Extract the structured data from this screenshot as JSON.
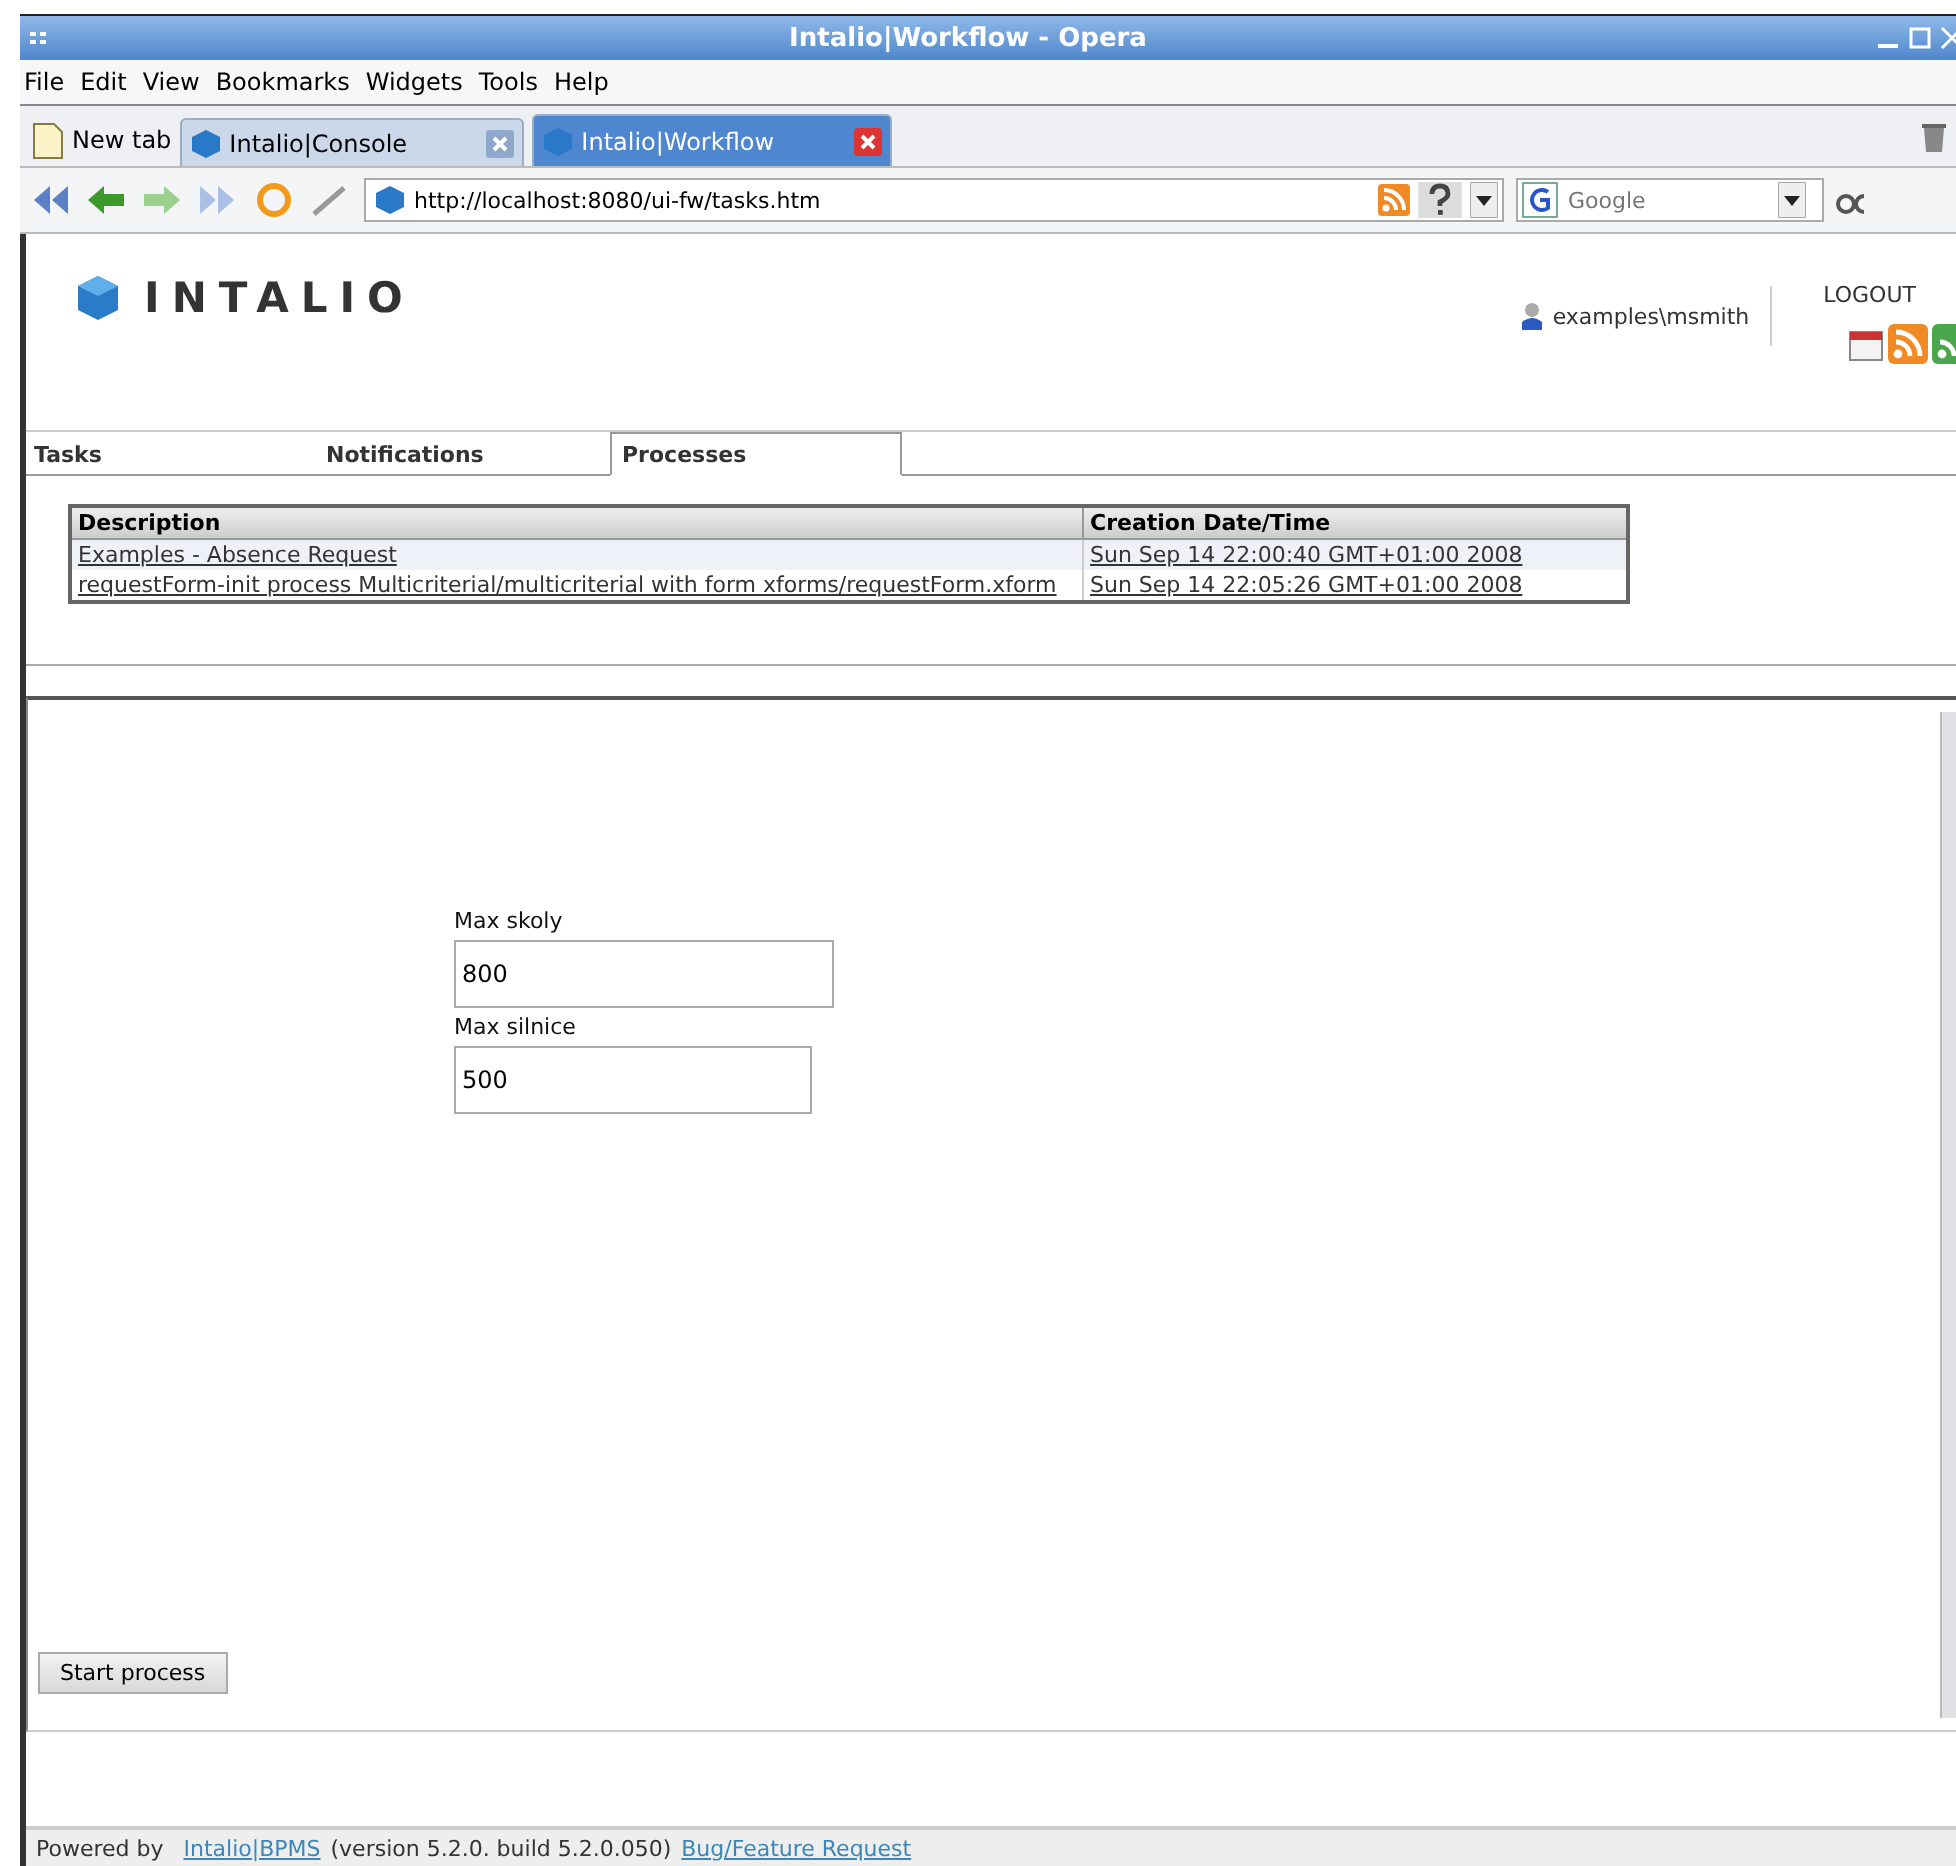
{
  "window": {
    "title": "Intalio|Workflow - Opera"
  },
  "menu": [
    "File",
    "Edit",
    "View",
    "Bookmarks",
    "Widgets",
    "Tools",
    "Help"
  ],
  "browser_tabs": [
    {
      "label": "New tab",
      "kind": "new"
    },
    {
      "label": "Intalio|Console",
      "kind": "page",
      "selected": false
    },
    {
      "label": "Intalio|Workflow",
      "kind": "page",
      "selected": true
    }
  ],
  "address": {
    "url": "http://localhost:8080/ui-fw/tasks.htm"
  },
  "search": {
    "placeholder": "Google"
  },
  "header": {
    "logo": "INTALIO",
    "user": "examples\\msmith",
    "logout": "LOGOUT"
  },
  "app_tabs": [
    {
      "label": "Tasks",
      "selected": false
    },
    {
      "label": "Notifications",
      "selected": false
    },
    {
      "label": "Processes",
      "selected": true
    }
  ],
  "table": {
    "columns": [
      "Description",
      "Creation Date/Time"
    ],
    "rows": [
      [
        "Examples - Absence Request",
        "Sun Sep 14 22:00:40 GMT+01:00 2008"
      ],
      [
        "requestForm-init process Multicriterial/multicriterial with form xforms/requestForm.xform",
        "Sun Sep 14 22:05:26 GMT+01:00 2008"
      ]
    ]
  },
  "form": {
    "fields": [
      {
        "label": "Max skoly",
        "value": "800"
      },
      {
        "label": "Max silnice",
        "value": "500"
      }
    ],
    "button": "Start process"
  },
  "footer": {
    "prefix": "Powered by",
    "product_link": "Intalio|BPMS",
    "version": "(version 5.2.0. build 5.2.0.050)",
    "feedback_link": "Bug/Feature Request"
  }
}
